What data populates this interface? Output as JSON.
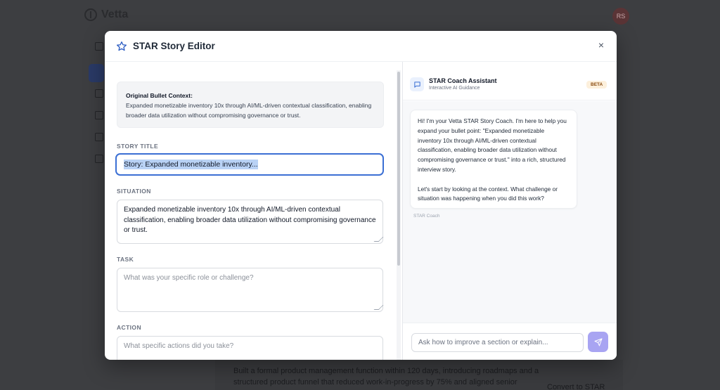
{
  "background": {
    "app_name": "Vetta",
    "avatar_initials": "RS",
    "card_text": "Built a formal product management function within 120 days, introducing roadmaps and a structured product funnel that reduced work-in-progress by 75% and aligned senior",
    "convert_label": "Convert to STAR"
  },
  "modal": {
    "title": "STAR Story Editor",
    "close_label": "×"
  },
  "editor": {
    "context_label": "Original Bullet Context:",
    "context_text": "Expanded monetizable inventory 10x through AI/ML-driven contextual classification, enabling broader data utilization without compromising governance or trust.",
    "story_title_label": "STORY TITLE",
    "story_title_value": "Story: Expanded monetizable inventory...",
    "situation_label": "SITUATION",
    "situation_value": "Expanded monetizable inventory 10x through AI/ML-driven contextual classification, enabling broader data utilization without compromising governance or trust.",
    "task_label": "TASK",
    "task_placeholder": "What was your specific role or challenge?",
    "action_label": "ACTION",
    "action_placeholder": "What specific actions did you take?"
  },
  "coach": {
    "name": "STAR Coach Assistant",
    "subtitle": "Interactive AI Guidance",
    "badge": "BETA",
    "message_p1": "Hi! I'm your Vetta STAR Story Coach. I'm here to help you expand your bullet point: \"Expanded monetizable inventory 10x through AI/ML-driven contextual classification, enabling broader data utilization without compromising governance or trust.\" into a rich, structured interview story.",
    "message_p2": "Let's start by looking at the context. What challenge or situation was happening when you did this work?",
    "message_from": "STAR Coach",
    "input_placeholder": "Ask how to improve a section or explain..."
  },
  "colors": {
    "accent": "#3b6fd4",
    "send_button": "#a8a4f2",
    "beta_bg": "#fdf0dc"
  }
}
